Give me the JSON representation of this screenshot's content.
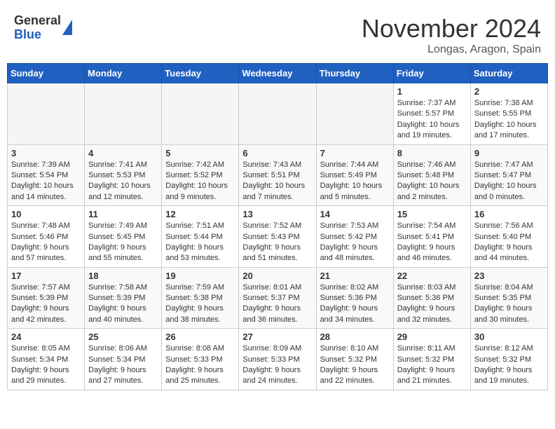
{
  "header": {
    "logo_general": "General",
    "logo_blue": "Blue",
    "month_title": "November 2024",
    "location": "Longas, Aragon, Spain"
  },
  "calendar": {
    "days_of_week": [
      "Sunday",
      "Monday",
      "Tuesday",
      "Wednesday",
      "Thursday",
      "Friday",
      "Saturday"
    ],
    "weeks": [
      [
        {
          "day": "",
          "empty": true
        },
        {
          "day": "",
          "empty": true
        },
        {
          "day": "",
          "empty": true
        },
        {
          "day": "",
          "empty": true
        },
        {
          "day": "",
          "empty": true
        },
        {
          "day": "1",
          "sunrise": "Sunrise: 7:37 AM",
          "sunset": "Sunset: 5:57 PM",
          "daylight": "Daylight: 10 hours and 19 minutes."
        },
        {
          "day": "2",
          "sunrise": "Sunrise: 7:38 AM",
          "sunset": "Sunset: 5:55 PM",
          "daylight": "Daylight: 10 hours and 17 minutes."
        }
      ],
      [
        {
          "day": "3",
          "sunrise": "Sunrise: 7:39 AM",
          "sunset": "Sunset: 5:54 PM",
          "daylight": "Daylight: 10 hours and 14 minutes."
        },
        {
          "day": "4",
          "sunrise": "Sunrise: 7:41 AM",
          "sunset": "Sunset: 5:53 PM",
          "daylight": "Daylight: 10 hours and 12 minutes."
        },
        {
          "day": "5",
          "sunrise": "Sunrise: 7:42 AM",
          "sunset": "Sunset: 5:52 PM",
          "daylight": "Daylight: 10 hours and 9 minutes."
        },
        {
          "day": "6",
          "sunrise": "Sunrise: 7:43 AM",
          "sunset": "Sunset: 5:51 PM",
          "daylight": "Daylight: 10 hours and 7 minutes."
        },
        {
          "day": "7",
          "sunrise": "Sunrise: 7:44 AM",
          "sunset": "Sunset: 5:49 PM",
          "daylight": "Daylight: 10 hours and 5 minutes."
        },
        {
          "day": "8",
          "sunrise": "Sunrise: 7:46 AM",
          "sunset": "Sunset: 5:48 PM",
          "daylight": "Daylight: 10 hours and 2 minutes."
        },
        {
          "day": "9",
          "sunrise": "Sunrise: 7:47 AM",
          "sunset": "Sunset: 5:47 PM",
          "daylight": "Daylight: 10 hours and 0 minutes."
        }
      ],
      [
        {
          "day": "10",
          "sunrise": "Sunrise: 7:48 AM",
          "sunset": "Sunset: 5:46 PM",
          "daylight": "Daylight: 9 hours and 57 minutes."
        },
        {
          "day": "11",
          "sunrise": "Sunrise: 7:49 AM",
          "sunset": "Sunset: 5:45 PM",
          "daylight": "Daylight: 9 hours and 55 minutes."
        },
        {
          "day": "12",
          "sunrise": "Sunrise: 7:51 AM",
          "sunset": "Sunset: 5:44 PM",
          "daylight": "Daylight: 9 hours and 53 minutes."
        },
        {
          "day": "13",
          "sunrise": "Sunrise: 7:52 AM",
          "sunset": "Sunset: 5:43 PM",
          "daylight": "Daylight: 9 hours and 51 minutes."
        },
        {
          "day": "14",
          "sunrise": "Sunrise: 7:53 AM",
          "sunset": "Sunset: 5:42 PM",
          "daylight": "Daylight: 9 hours and 48 minutes."
        },
        {
          "day": "15",
          "sunrise": "Sunrise: 7:54 AM",
          "sunset": "Sunset: 5:41 PM",
          "daylight": "Daylight: 9 hours and 46 minutes."
        },
        {
          "day": "16",
          "sunrise": "Sunrise: 7:56 AM",
          "sunset": "Sunset: 5:40 PM",
          "daylight": "Daylight: 9 hours and 44 minutes."
        }
      ],
      [
        {
          "day": "17",
          "sunrise": "Sunrise: 7:57 AM",
          "sunset": "Sunset: 5:39 PM",
          "daylight": "Daylight: 9 hours and 42 minutes."
        },
        {
          "day": "18",
          "sunrise": "Sunrise: 7:58 AM",
          "sunset": "Sunset: 5:39 PM",
          "daylight": "Daylight: 9 hours and 40 minutes."
        },
        {
          "day": "19",
          "sunrise": "Sunrise: 7:59 AM",
          "sunset": "Sunset: 5:38 PM",
          "daylight": "Daylight: 9 hours and 38 minutes."
        },
        {
          "day": "20",
          "sunrise": "Sunrise: 8:01 AM",
          "sunset": "Sunset: 5:37 PM",
          "daylight": "Daylight: 9 hours and 36 minutes."
        },
        {
          "day": "21",
          "sunrise": "Sunrise: 8:02 AM",
          "sunset": "Sunset: 5:36 PM",
          "daylight": "Daylight: 9 hours and 34 minutes."
        },
        {
          "day": "22",
          "sunrise": "Sunrise: 8:03 AM",
          "sunset": "Sunset: 5:36 PM",
          "daylight": "Daylight: 9 hours and 32 minutes."
        },
        {
          "day": "23",
          "sunrise": "Sunrise: 8:04 AM",
          "sunset": "Sunset: 5:35 PM",
          "daylight": "Daylight: 9 hours and 30 minutes."
        }
      ],
      [
        {
          "day": "24",
          "sunrise": "Sunrise: 8:05 AM",
          "sunset": "Sunset: 5:34 PM",
          "daylight": "Daylight: 9 hours and 29 minutes."
        },
        {
          "day": "25",
          "sunrise": "Sunrise: 8:06 AM",
          "sunset": "Sunset: 5:34 PM",
          "daylight": "Daylight: 9 hours and 27 minutes."
        },
        {
          "day": "26",
          "sunrise": "Sunrise: 8:08 AM",
          "sunset": "Sunset: 5:33 PM",
          "daylight": "Daylight: 9 hours and 25 minutes."
        },
        {
          "day": "27",
          "sunrise": "Sunrise: 8:09 AM",
          "sunset": "Sunset: 5:33 PM",
          "daylight": "Daylight: 9 hours and 24 minutes."
        },
        {
          "day": "28",
          "sunrise": "Sunrise: 8:10 AM",
          "sunset": "Sunset: 5:32 PM",
          "daylight": "Daylight: 9 hours and 22 minutes."
        },
        {
          "day": "29",
          "sunrise": "Sunrise: 8:11 AM",
          "sunset": "Sunset: 5:32 PM",
          "daylight": "Daylight: 9 hours and 21 minutes."
        },
        {
          "day": "30",
          "sunrise": "Sunrise: 8:12 AM",
          "sunset": "Sunset: 5:32 PM",
          "daylight": "Daylight: 9 hours and 19 minutes."
        }
      ]
    ]
  }
}
